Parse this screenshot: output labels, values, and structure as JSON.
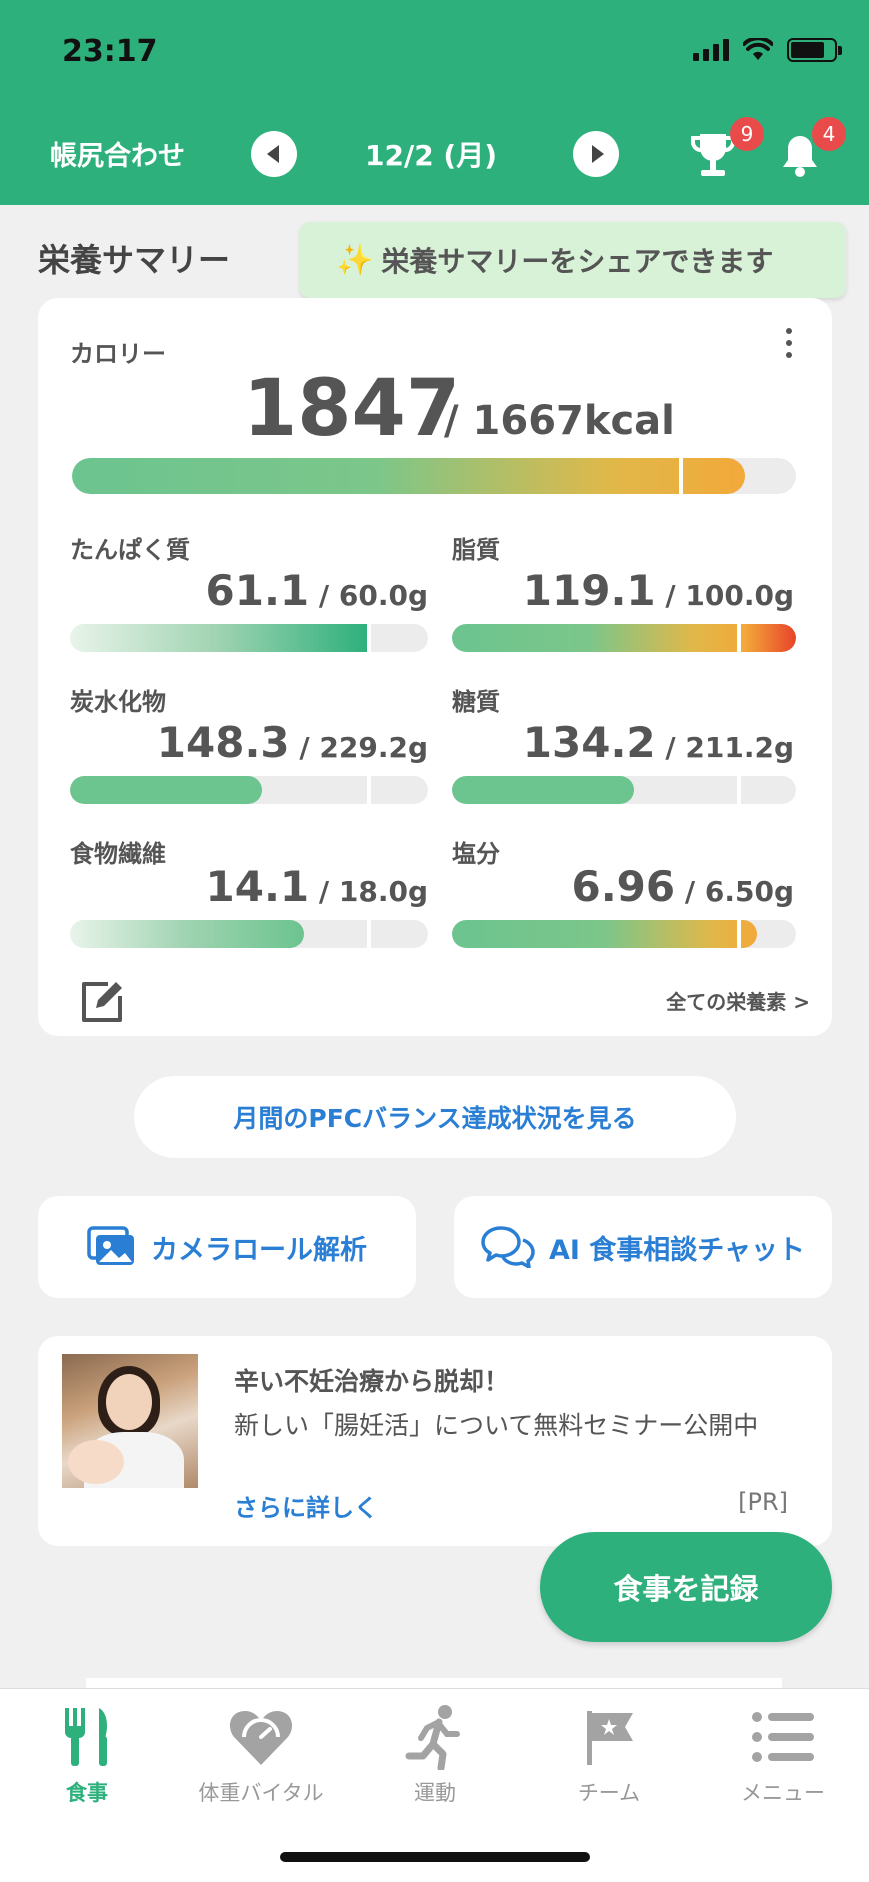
{
  "status": {
    "time": "23:17"
  },
  "header": {
    "title": "帳尻合わせ",
    "date": "12/2 (月)",
    "trophy_badge": "9",
    "bell_badge": "4"
  },
  "summary": {
    "title": "栄養サマリー",
    "tooltip": "栄養サマリーをシェアできます"
  },
  "calorie": {
    "label": "カロリー",
    "value": "1847",
    "target": "/ 1667kcal",
    "progress": 1.108
  },
  "nutrients": [
    {
      "label": "たんぱく質",
      "value": "61.1",
      "target": " / 60.0g",
      "progress": 1.018
    },
    {
      "label": "脂質",
      "value": "119.1",
      "target": " / 100.0g",
      "progress": 1.191
    },
    {
      "label": "炭水化物",
      "value": "148.3",
      "target": " / 229.2g",
      "progress": 0.647
    },
    {
      "label": "糖質",
      "value": "134.2",
      "target": " / 211.2g",
      "progress": 0.635
    },
    {
      "label": "食物繊維",
      "value": "14.1",
      "target": " / 18.0g",
      "progress": 0.783
    },
    {
      "label": "塩分",
      "value": "6.96",
      "target": " / 6.50g",
      "progress": 1.071
    }
  ],
  "card_footer": {
    "all_nutrients": "全ての栄養素 >"
  },
  "pfc_button": "月間のPFCバランス達成状況を見る",
  "actions": {
    "camera_roll": "カメラロール解析",
    "ai_chat": "AI 食事相談チャット"
  },
  "ad": {
    "title": "辛い不妊治療から脱却！",
    "text": "新しい「腸妊活」について無料セミナー公開中",
    "more": "さらに詳しく",
    "pr": "[PR]"
  },
  "record_button": "食事を記録",
  "tabs": [
    {
      "label": "食事",
      "icon": "fork-knife-icon",
      "active": true
    },
    {
      "label": "体重バイタル",
      "icon": "heart-scale-icon",
      "active": false
    },
    {
      "label": "運動",
      "icon": "runner-icon",
      "active": false
    },
    {
      "label": "チーム",
      "icon": "flag-icon",
      "active": false
    },
    {
      "label": "メニュー",
      "icon": "list-icon",
      "active": false
    }
  ],
  "colors": {
    "brand": "#2eb07c",
    "link": "#2a7fd4",
    "badge": "#e94b4b",
    "tooltip_bg": "#d8f2d8"
  }
}
